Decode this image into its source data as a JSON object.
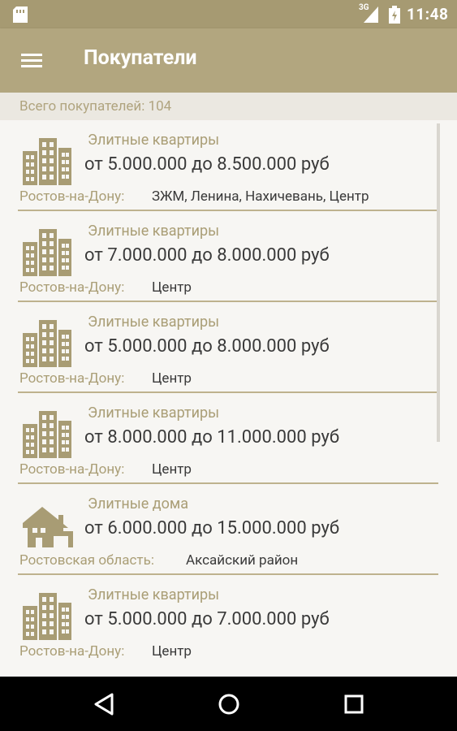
{
  "status_bar": {
    "network_label": "3G",
    "time": "11:48"
  },
  "app_bar": {
    "title": "Покупатели",
    "menu_icon": "hamburger-menu-icon"
  },
  "summary": {
    "text": "Всего покупателей: 104"
  },
  "listings": [
    {
      "icon": "apartment-building-icon",
      "category": "Элитные квартиры",
      "price": "от 5.000.000 до 8.500.000 руб",
      "region": "Ростов-на-Дону:",
      "district": "ЗЖМ, Ленина, Нахичевань, Центр"
    },
    {
      "icon": "apartment-building-icon",
      "category": "Элитные квартиры",
      "price": "от 7.000.000 до 8.000.000 руб",
      "region": "Ростов-на-Дону:",
      "district": "Центр"
    },
    {
      "icon": "apartment-building-icon",
      "category": "Элитные квартиры",
      "price": "от 5.000.000 до 8.000.000 руб",
      "region": "Ростов-на-Дону:",
      "district": "Центр"
    },
    {
      "icon": "apartment-building-icon",
      "category": "Элитные квартиры",
      "price": "от 8.000.000 до 11.000.000 руб",
      "region": "Ростов-на-Дону:",
      "district": "Центр"
    },
    {
      "icon": "house-icon",
      "category": "Элитные дома",
      "price": "от 6.000.000 до 15.000.000 руб",
      "region": "Ростовская область:",
      "district": "Аксайский район"
    },
    {
      "icon": "apartment-building-icon",
      "category": "Элитные квартиры",
      "price": "от 5.000.000 до 7.000.000 руб",
      "region": "Ростов-на-Дону:",
      "district": "Центр"
    }
  ],
  "nav_bar": {
    "back_icon": "back-triangle-icon",
    "home_icon": "home-circle-icon",
    "recent_icon": "recent-apps-square-icon"
  },
  "colors": {
    "status_bar": "#a69a72",
    "app_bar": "#b2a67f",
    "accent_text": "#aa9e76",
    "divider": "#beb28e"
  }
}
